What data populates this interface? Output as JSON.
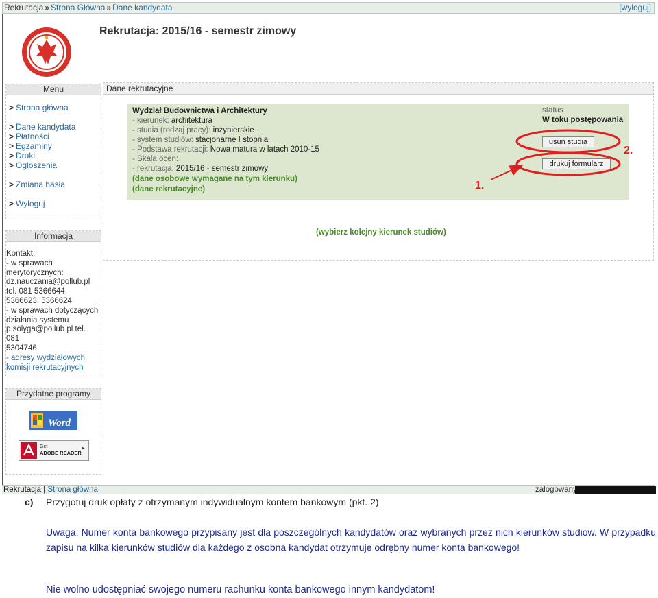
{
  "breadcrumb": {
    "root": "Rekrutacja",
    "items": [
      "Strona Główna",
      "Dane kandydata"
    ],
    "logout": "[wyloguj]"
  },
  "header": {
    "title": "Rekrutacja: 2015/16 - semestr zimowy"
  },
  "menu": {
    "title": "Menu",
    "items": [
      "Strona główna",
      "Dane kandydata",
      "Płatności",
      "Egzaminy",
      "Druki",
      "Ogłoszenia",
      "Zmiana hasła",
      "Wyloguj"
    ]
  },
  "info": {
    "title": "Informacja",
    "lines": [
      "Kontakt:",
      "- w sprawach",
      "merytorycznych:",
      "dz.nauczania@pollub.pl",
      "tel. 081 5366644,",
      "5366623, 5366624",
      "- w sprawach dotyczących",
      "działania systemu",
      "p.solyga@pollub.pl tel. 081",
      "5304746"
    ],
    "link_lines": [
      "- adresy wydziałowych",
      "komisji rekrutacyjnych"
    ]
  },
  "programs": {
    "title": "Przydatne programy",
    "word_label": "Word",
    "adobe_label_top": "Get",
    "adobe_label": "ADOBE READER"
  },
  "main": {
    "title": "Dane rekrutacyjne",
    "faculty": "Wydział Budownictwa i Architektury",
    "fields": [
      {
        "label": "- kierunek:",
        "value": "architektura"
      },
      {
        "label": "- studia (rodzaj pracy):",
        "value": "inżynierskie"
      },
      {
        "label": "- system studiów:",
        "value": "stacjonarne I stopnia"
      },
      {
        "label": "- Podstawa rekrutacji:",
        "value": "Nowa matura w latach 2010-15"
      },
      {
        "label": "- Skala ocen:",
        "value": ""
      },
      {
        "label": "- rekrutacja:",
        "value": "2015/16 - semestr zimowy"
      }
    ],
    "links": [
      "(dane osobowe wymagane na tym kierunku)",
      "(dane rekrutacyjne)"
    ],
    "status_label": "status",
    "status_value": "W toku postępowania",
    "remove_button": "usuń studia",
    "print_button": "drukuj formularz",
    "next_link": "(wybierz kolejny kierunek studiów)"
  },
  "annotations": {
    "mark_1": "1.",
    "mark_2": "2.",
    "color": "#e02020"
  },
  "footer": {
    "root": "Rekrutacja",
    "link": "Strona główna",
    "logged_label": "zalogowany:"
  },
  "document": {
    "item_letter": "c)",
    "item_text": "Przygotuj druk opłaty z otrzymanym indywidualnym kontem bankowym (pkt. 2)",
    "note": "Uwaga: Numer konta bankowego przypisany jest dla poszczególnych kandydatów oraz wybranych przez nich kierunków studiów. W przypadku zapisu na kilka kierunków studiów dla każdego z osobna kandydat otrzymuje odrębny numer konta bankowego!",
    "warning": "Nie wolno udostępniać swojego numeru rachunku konta bankowego innym kandydatom!"
  }
}
